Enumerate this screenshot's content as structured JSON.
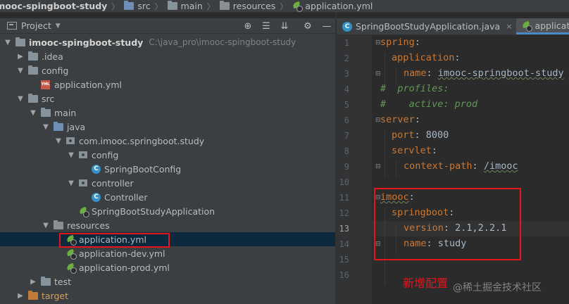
{
  "breadcrumb": {
    "items": [
      "imooc-spingboot-study",
      "src",
      "main",
      "resources",
      "application.yml"
    ]
  },
  "project_panel": {
    "title": "Project",
    "tools": [
      "crosshair-icon",
      "collapse-all-icon",
      "expand-all-icon",
      "gear-icon",
      "minimize-icon"
    ]
  },
  "tree": {
    "root_label": "imooc-spingboot-study",
    "root_path": "C:\\java_pro\\imooc-spingboot-study",
    "idea": ".idea",
    "config": "config",
    "config_app_yml": "application.yml",
    "src": "src",
    "main": "main",
    "java": "java",
    "package": "com.imooc.springboot.study",
    "pkg_config": "config",
    "spring_boot_config": "SpringBootConfig",
    "controller_pkg": "controller",
    "controller_class": "Controller",
    "app_class": "SpringBootStudyApplication",
    "resources": "resources",
    "res_app_yml": "application.yml",
    "res_app_dev_yml": "application-dev.yml",
    "res_app_prod_yml": "application-prod.yml",
    "test": "test",
    "target": "target"
  },
  "tabs": [
    {
      "label": "SpringBootStudyApplication.java",
      "close": "×"
    },
    {
      "label": "application",
      "close": ""
    }
  ],
  "editor": {
    "line_numbers": [
      "1",
      "2",
      "3",
      "4",
      "5",
      "6",
      "7",
      "8",
      "9",
      "10",
      "11",
      "12",
      "13",
      "14",
      "15",
      "16"
    ],
    "lines": {
      "l1_key": "spring",
      "l1_colon": ":",
      "l2_key": "application",
      "l2_colon": ":",
      "l3_key": "name",
      "l3_colon": ": ",
      "l3_val": "imooc-springboot-study",
      "l4_comment": "#  profiles:",
      "l5_comment": "#    active: prod",
      "l6_key": "server",
      "l6_colon": ":",
      "l7_key": "port",
      "l7_colon": ": ",
      "l7_val": "8000",
      "l8_key": "servlet",
      "l8_colon": ":",
      "l9_key": "context-path",
      "l9_colon": ": ",
      "l9_val": "/imooc",
      "l11_key": "imooc",
      "l11_colon": ":",
      "l12_key": "springboot",
      "l12_colon": ":",
      "l13_key": "version",
      "l13_colon": ": ",
      "l13_val": "2.1,2.2.1",
      "l14_key": "name",
      "l14_colon": ": ",
      "l14_val": "study"
    }
  },
  "annotation": "新增配置",
  "watermark": "@稀土掘金技术社区",
  "colors": {
    "highlight_red": "#e8141c",
    "yaml_key": "#cc7832",
    "yaml_value": "#a9b7c6",
    "comment": "#629755",
    "selection": "#0d293e"
  }
}
